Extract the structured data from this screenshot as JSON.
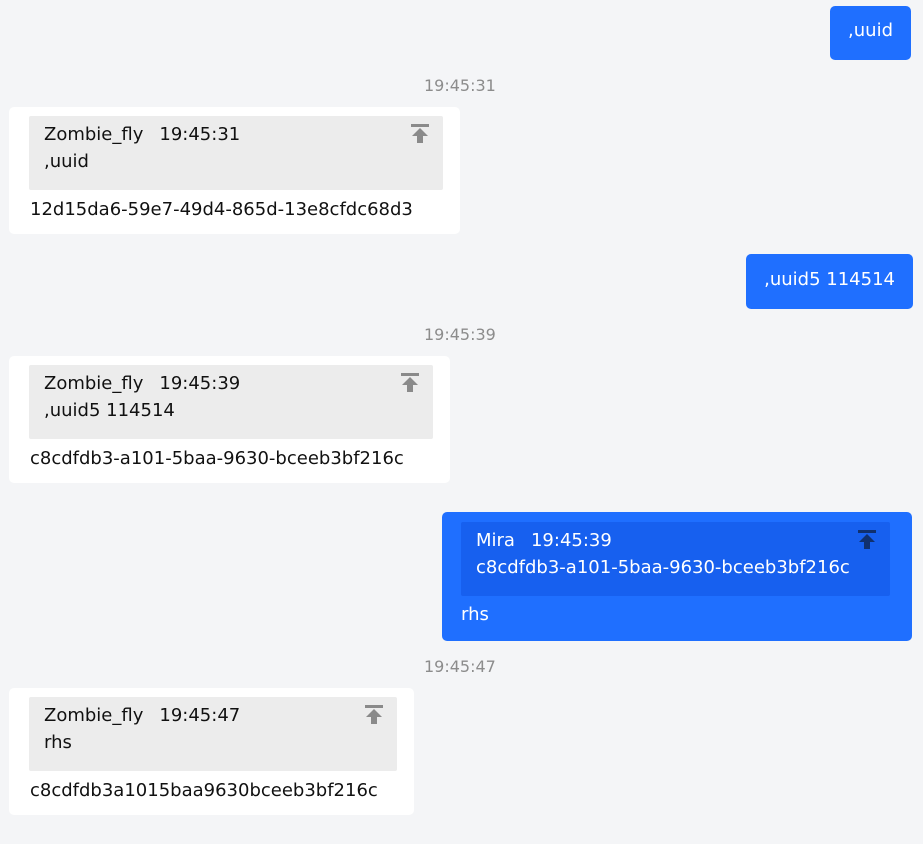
{
  "messages": [
    {
      "type": "outgoing",
      "text": ",uuid"
    },
    {
      "type": "timestamp",
      "text": "19:45:31"
    },
    {
      "type": "incoming",
      "quote": {
        "author": "Zombie_fly",
        "time": "19:45:31",
        "text": ",uuid"
      },
      "text": "12d15da6-59e7-49d4-865d-13e8cfdc68d3"
    },
    {
      "type": "outgoing",
      "text": ",uuid5 114514"
    },
    {
      "type": "timestamp",
      "text": "19:45:39"
    },
    {
      "type": "incoming",
      "quote": {
        "author": "Zombie_fly",
        "time": "19:45:39",
        "text": ",uuid5 114514"
      },
      "text": "c8cdfdb3-a101-5baa-9630-bceeb3bf216c"
    },
    {
      "type": "outgoing",
      "quote": {
        "author": "Mira",
        "time": "19:45:39",
        "text": "c8cdfdb3-a101-5baa-9630-bceeb3bf216c"
      },
      "text": "rhs"
    },
    {
      "type": "timestamp",
      "text": "19:45:47"
    },
    {
      "type": "incoming",
      "quote": {
        "author": "Zombie_fly",
        "time": "19:45:47",
        "text": "rhs"
      },
      "text": "c8cdfdb3a1015baa9630bceeb3bf216c"
    }
  ],
  "icons": {
    "pin": "pin-to-top-icon"
  },
  "colors": {
    "outgoing_bubble": "#1f6fff",
    "incoming_bubble": "#ffffff",
    "background": "#f4f5f7",
    "timestamp": "#8c8c8c"
  }
}
